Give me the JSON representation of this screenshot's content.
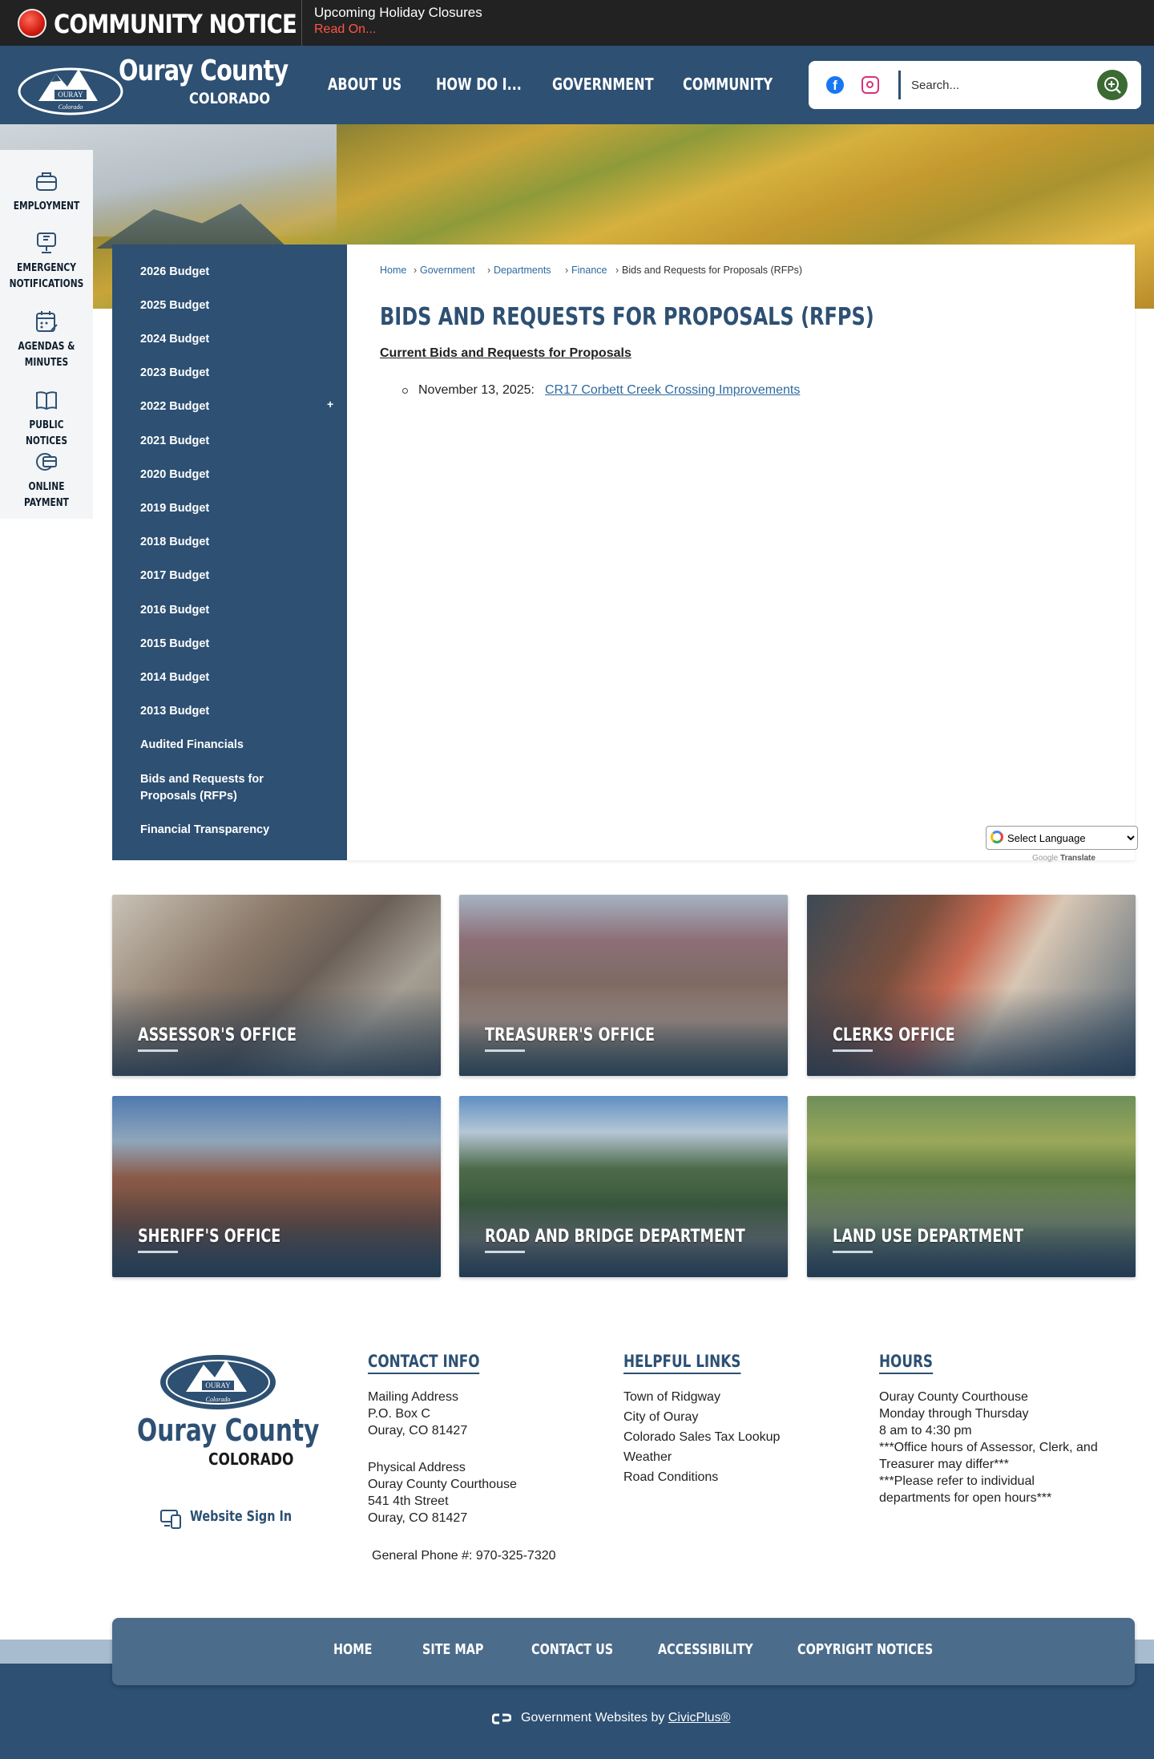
{
  "notice": {
    "title": "COMMUNITY NOTICE",
    "text": "Upcoming Holiday Closures",
    "link": "Read On..."
  },
  "header": {
    "logo_name": "Ouray County",
    "logo_state": "COLORADO",
    "nav": [
      "ABOUT US",
      "HOW DO I...",
      "GOVERNMENT",
      "COMMUNITY"
    ],
    "search_placeholder": "Search..."
  },
  "quick_links": [
    {
      "label_1": "EMPLOYMENT",
      "label_2": "",
      "icon": "briefcase-icon"
    },
    {
      "label_1": "EMERGENCY",
      "label_2": "NOTIFICATIONS",
      "icon": "alert-monitor-icon"
    },
    {
      "label_1": "AGENDAS &",
      "label_2": "MINUTES",
      "icon": "calendar-icon"
    },
    {
      "label_1": "PUBLIC NOTICES",
      "label_2": "",
      "icon": "book-icon"
    },
    {
      "label_1": "ONLINE PAYMENT",
      "label_2": "",
      "icon": "payment-icon"
    }
  ],
  "side_menu": [
    "2026 Budget",
    "2025 Budget",
    "2024 Budget",
    "2023 Budget",
    "2022 Budget",
    "2021 Budget",
    "2020 Budget",
    "2019 Budget",
    "2018 Budget",
    "2017 Budget",
    "2016 Budget",
    "2015 Budget",
    "2014 Budget",
    "2013 Budget",
    "Audited Financials",
    "Bids and Requests for",
    "Proposals (RFPs)",
    "Financial Transparency"
  ],
  "side_menu_expand": "+",
  "breadcrumb": {
    "home": "Home",
    "government": "Government",
    "departments": "Departments",
    "finance": "Finance",
    "current": "Bids and Requests for Proposals (RFPs)",
    "sep": "›"
  },
  "page": {
    "title": "BIDS AND REQUESTS FOR PROPOSALS (RFPS)",
    "subhead": "Current Bids and Requests for Proposals",
    "bid_date": "November 13, 2025:",
    "bid_link": "CR17 Corbett Creek Crossing Improvements"
  },
  "translate": {
    "select": "Select Language",
    "powered_a": "Google",
    "powered_b": "Translate"
  },
  "cards": [
    "ASSESSOR'S OFFICE",
    "TREASURER'S OFFICE",
    "CLERKS OFFICE",
    "SHERIFF'S OFFICE",
    "ROAD AND BRIDGE DEPARTMENT",
    "LAND USE DEPARTMENT"
  ],
  "footer": {
    "name": "Ouray County",
    "state": "COLORADO",
    "signin": "Website Sign In",
    "contact": {
      "heading": "CONTACT INFO",
      "lines": [
        "Mailing Address",
        "P.O. Box C",
        "Ouray, CO 81427"
      ],
      "lines2": [
        "Physical Address",
        "Ouray County Courthouse",
        "541 4th Street",
        "Ouray, CO 81427"
      ],
      "phone": "General Phone #: 970-325-7320"
    },
    "links": {
      "heading": "HELPFUL LINKS",
      "items": [
        "Town of Ridgway",
        "City of Ouray",
        "Colorado Sales Tax Lookup",
        "Weather",
        "Road Conditions"
      ]
    },
    "hours": {
      "heading": "HOURS",
      "lines": [
        "Ouray County Courthouse",
        "Monday through Thursday",
        "8 am to 4:30 pm",
        "***Office hours of Assessor, Clerk, and",
        "Treasurer may differ***",
        "***Please refer to individual",
        "departments for open hours***"
      ]
    }
  },
  "bottom_nav": [
    "HOME",
    "SITE MAP",
    "CONTACT US",
    "ACCESSIBILITY",
    "COPYRIGHT NOTICES"
  ],
  "civic": {
    "text": "Government Websites by ",
    "link": "CivicPlus®"
  },
  "colors": {
    "brand": "#2d5073",
    "accent": "#3b6a32",
    "notice_link": "#ff5546"
  }
}
